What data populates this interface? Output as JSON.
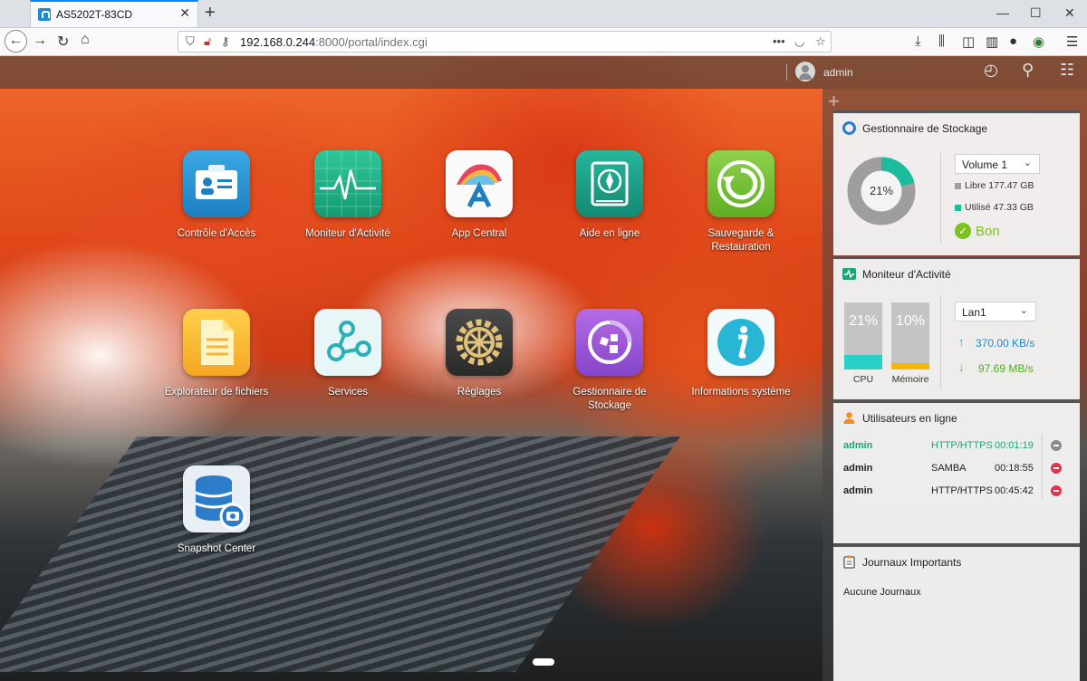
{
  "browser": {
    "tab_title": "AS5202T-83CD",
    "url_host": "192.168.0.244",
    "url_path": ":8000/portal/index.cgi"
  },
  "adm": {
    "user": "admin",
    "apps": [
      {
        "label": "Contrôle d'Accès",
        "icon": "access-control-icon"
      },
      {
        "label": "Moniteur d'Activité",
        "icon": "activity-monitor-icon"
      },
      {
        "label": "App Central",
        "icon": "app-central-icon"
      },
      {
        "label": "Aide en ligne",
        "icon": "online-help-icon"
      },
      {
        "label": "Sauvegarde & Restauration",
        "icon": "backup-restore-icon"
      },
      {
        "label": "Explorateur de fichiers",
        "icon": "file-explorer-icon"
      },
      {
        "label": "Services",
        "icon": "services-icon"
      },
      {
        "label": "Réglages",
        "icon": "settings-gear-icon"
      },
      {
        "label": "Gestionnaire de Stockage",
        "icon": "storage-manager-icon"
      },
      {
        "label": "Informations système",
        "icon": "system-info-icon"
      },
      {
        "label": "Snapshot Center",
        "icon": "snapshot-center-icon"
      }
    ]
  },
  "widgets": {
    "storage": {
      "title": "Gestionnaire de Stockage",
      "usage_percent_label": "21%",
      "usage_fraction": 0.21,
      "volume": "Volume 1",
      "free": "Libre 177.47 GB",
      "used": "Utilisé 47.33 GB",
      "status": "Bon",
      "colors": {
        "used": "#1abc9c",
        "free": "#9e9e9e"
      }
    },
    "activity": {
      "title": "Moniteur d'Activité",
      "cpu_label": "CPU",
      "cpu_pct": "21%",
      "cpu_fraction": 0.21,
      "mem_label": "Mémoire",
      "mem_pct": "10%",
      "mem_fraction": 0.1,
      "network": "Lan1",
      "upload": "370.00 KB/s",
      "download": "97.69 MB/s"
    },
    "users": {
      "title": "Utilisateurs en ligne",
      "rows": [
        {
          "name": "admin",
          "protocol": "HTTP/HTTPS",
          "time": "00:01:19",
          "current": true
        },
        {
          "name": "admin",
          "protocol": "SAMBA",
          "time": "00:18:55",
          "current": false
        },
        {
          "name": "admin",
          "protocol": "HTTP/HTTPS",
          "time": "00:45:42",
          "current": false
        }
      ]
    },
    "logs": {
      "title": "Journaux Importants",
      "empty": "Aucune Journaux"
    }
  }
}
